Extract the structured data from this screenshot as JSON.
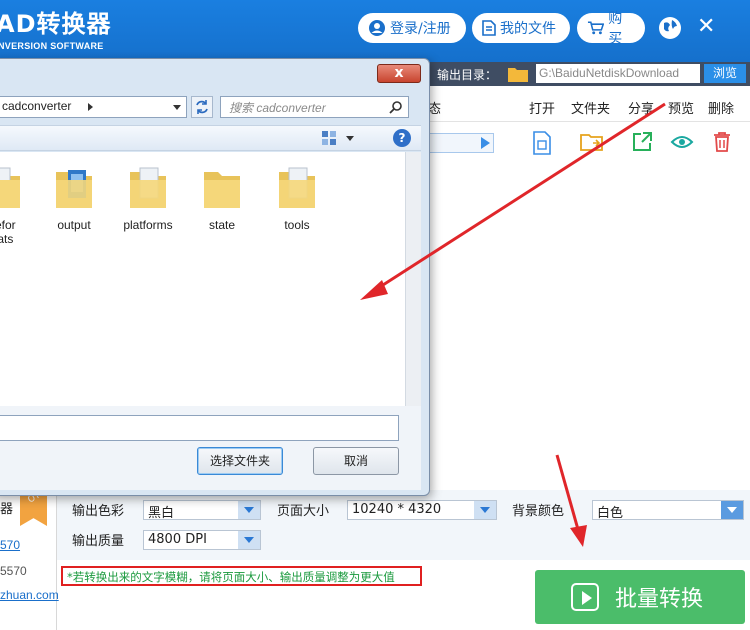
{
  "header": {
    "brand": "AD转换器",
    "brand_sub": "NVERSION SOFTWARE",
    "login": "登录/注册",
    "my_files": "我的文件",
    "buy": "购买"
  },
  "output": {
    "label": "输出目录：",
    "path": "G:\\BaiduNetdiskDownload",
    "browse": "浏览"
  },
  "columns": {
    "status": "态",
    "open": "打开",
    "folder": "文件夹",
    "share": "分享",
    "preview": "预览",
    "delete": "删除"
  },
  "dialog": {
    "address": "cadconverter",
    "search_placeholder": "搜索 cadconverter",
    "folders": [
      {
        "label": "gefor\nhats"
      },
      {
        "label": "output"
      },
      {
        "label": "platforms"
      },
      {
        "label": "state"
      },
      {
        "label": "tools"
      }
    ],
    "select_folder": "选择文件夹",
    "cancel": "取消",
    "close": "x"
  },
  "sidebar": {
    "title": "器",
    "badge": "OT",
    "line1": "570",
    "line2": "5570",
    "line3": "zhuan.com"
  },
  "settings": {
    "color_label": "输出色彩",
    "color_value": "黑白",
    "page_size_label": "页面大小",
    "page_size_value": "10240 * 4320",
    "bg_label": "背景颜色",
    "bg_value": "白色",
    "quality_label": "输出质量",
    "quality_value": "4800 DPI"
  },
  "tip": "*若转换出来的文字模糊，请将页面大小、输出质量调整为更大值",
  "convert_button": "批量转换",
  "colors": {
    "header_blue": "#1a7fe0",
    "convert_green": "#4bbd6a",
    "tip_border": "#e02020",
    "annotation_arrow": "#e0262a"
  }
}
